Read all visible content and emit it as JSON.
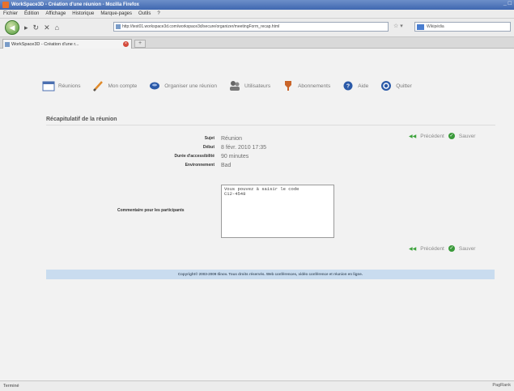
{
  "window": {
    "title": "WorkSpace3D - Création d'une réunion - Mozilla Firefox",
    "controls": "_ □"
  },
  "menubar": {
    "items": [
      "Fichier",
      "Édition",
      "Affichage",
      "Historique",
      "Marque-pages",
      "Outils",
      "?"
    ]
  },
  "navbar": {
    "url": "http://test01.workspace3d.com/workspace3d/secure/organizer/meetingForm_recap.html",
    "search_placeholder": "Wikipédia"
  },
  "tabs": [
    {
      "label": "WorkSpace3D - Création d'une r..."
    }
  ],
  "toolbar": {
    "items": [
      {
        "label": "Réunions",
        "icon": "calendar-icon"
      },
      {
        "label": "Mon compte",
        "icon": "pencil-icon"
      },
      {
        "label": "Organiser une réunion",
        "icon": "handshake-icon"
      },
      {
        "label": "Utilisateurs",
        "icon": "users-icon"
      },
      {
        "label": "Abonnements",
        "icon": "tag-icon"
      },
      {
        "label": "Aide",
        "icon": "help-icon"
      },
      {
        "label": "Quitter",
        "icon": "quit-icon"
      }
    ]
  },
  "recap": {
    "title": "Récapitulatif de la réunion",
    "fields": [
      {
        "label": "Sujet",
        "value": "Réunion"
      },
      {
        "label": "Début",
        "value": "8 févr. 2010 17:35"
      },
      {
        "label": "Durée d'accessibilité",
        "value": "90 minutes"
      },
      {
        "label": "Environnement",
        "value": "Bad"
      }
    ],
    "comment_label": "Commentaire pour les participants",
    "comment_value": "Vous pouvez à saisir le code\nC12-4548",
    "prev_label": "Précédent",
    "save_label": "Sauver"
  },
  "footer": {
    "text": "Copyright© 2003-2009 Ilinov. Tous droits réservés. Web conférences, vidéo conférence et réunion en ligne."
  },
  "statusbar": {
    "left": "Terminé",
    "right": "PagRank"
  }
}
